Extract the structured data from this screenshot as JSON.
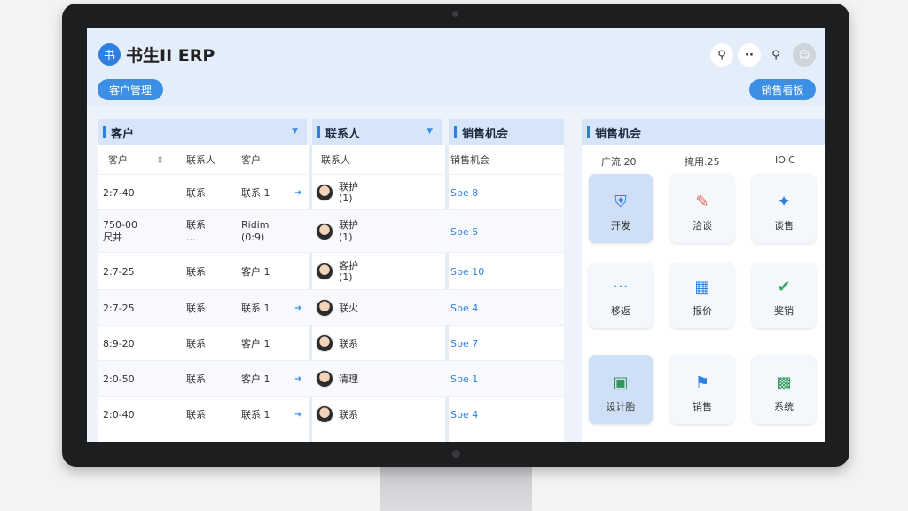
{
  "app": {
    "logo_glyph": "书",
    "title": "书生II ERP"
  },
  "header": {
    "left_pill": "客户管理",
    "right_pill": "销售看板",
    "icons": [
      "search-icon",
      "more-icon",
      "search-icon",
      "user-avatar"
    ]
  },
  "panels": {
    "customer": "客户",
    "contact": "联系人",
    "opportunity": "销售机会",
    "right": "销售机会"
  },
  "table": {
    "columns": [
      "客户",
      "联系人",
      "客户",
      "联系人",
      "销售机会"
    ],
    "rows": [
      {
        "date": "2:7-40",
        "a": "联系",
        "b": "联系 1",
        "contact": "联护",
        "contact2": "(1)",
        "opp": "Spe 8"
      },
      {
        "date": "750-00",
        "date2": "尺井",
        "a": "联系",
        "a2": "...",
        "b": "Ridim",
        "b2": "(0:9)",
        "contact": "联护",
        "contact2": "(1)",
        "opp": "Spe 5"
      },
      {
        "date": "2:7-25",
        "a": "联系",
        "b": "客户 1",
        "contact": "客护",
        "contact2": "(1)",
        "opp": "Spe 10"
      },
      {
        "date": "2:7-25",
        "a": "联系",
        "b": "联系 1",
        "contact": "联火",
        "opp": "Spe 4"
      },
      {
        "date": "8:9-20",
        "a": "联系",
        "b": "客户 1",
        "contact": "联系",
        "opp": "Spe 7"
      },
      {
        "date": "2:0-50",
        "a": "联系",
        "b": "客户 1",
        "contact": "清理",
        "opp": "Spe 1"
      },
      {
        "date": "2:0-40",
        "a": "联系",
        "b": "联系 1",
        "contact": "联系",
        "opp": "Spe 4"
      }
    ]
  },
  "tiles": {
    "col_heads": [
      "广流 20",
      "掩用.25",
      "IOIC"
    ],
    "items": [
      {
        "label": "开发",
        "icon": "shield-icon"
      },
      {
        "label": "洽谈",
        "icon": "pen-icon"
      },
      {
        "label": "谈售",
        "icon": "sparkle-icon"
      },
      {
        "label": "移返",
        "icon": "dots-icon"
      },
      {
        "label": "报价",
        "icon": "grid-icon"
      },
      {
        "label": "奖销",
        "icon": "check-icon"
      },
      {
        "label": "设计胎",
        "icon": "doc-icon"
      },
      {
        "label": "销售",
        "icon": "lock-icon"
      },
      {
        "label": "系统",
        "icon": "chart-icon"
      }
    ]
  }
}
